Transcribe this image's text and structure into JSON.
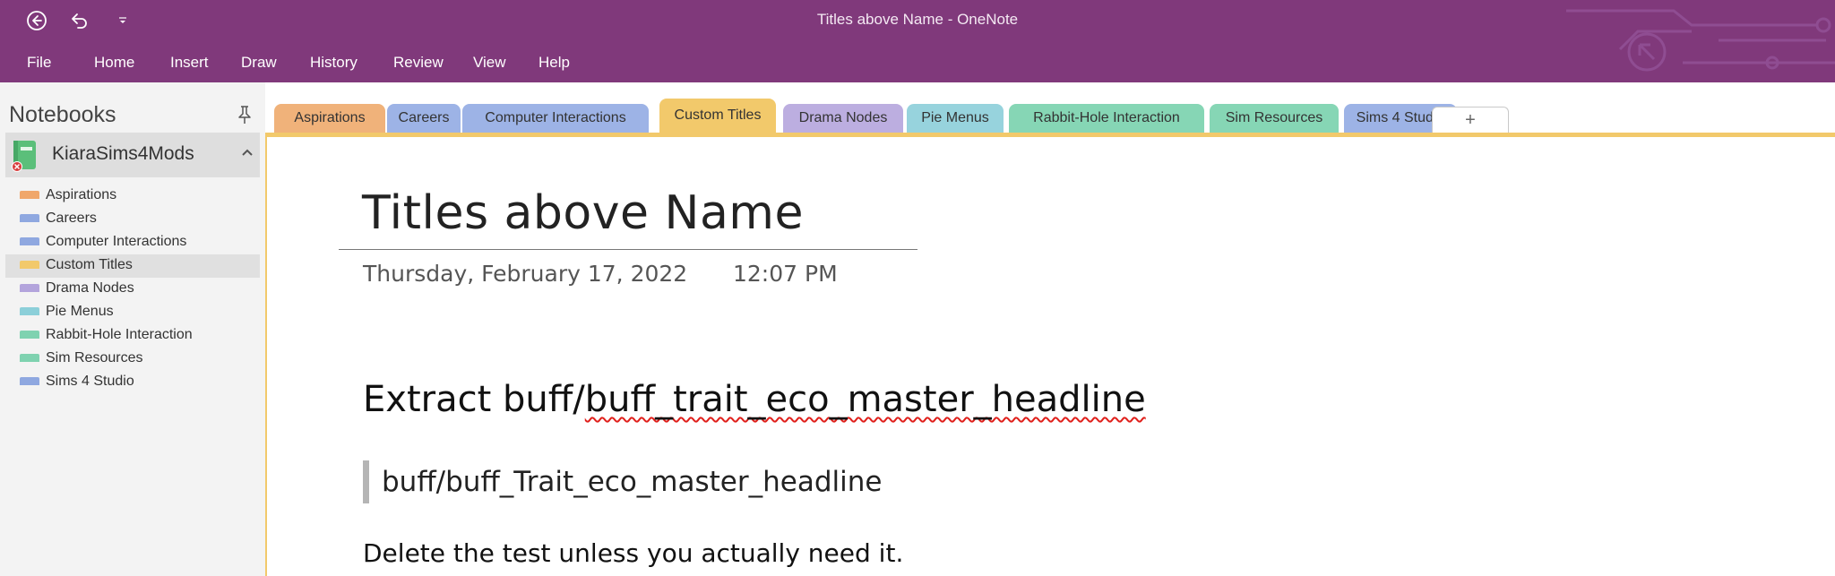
{
  "window": {
    "title": "Titles above Name  -  OneNote"
  },
  "qat": {
    "back_icon": "back-circle-icon",
    "undo_icon": "undo-icon",
    "customize_icon": "dropdown-caret-icon"
  },
  "ribbon": {
    "tabs": [
      "File",
      "Home",
      "Insert",
      "Draw",
      "History",
      "Review",
      "View",
      "Help"
    ]
  },
  "nav": {
    "title": "Notebooks",
    "notebook": {
      "name": "KiaraSims4Mods",
      "color": "#5bbf7a"
    },
    "sections": [
      {
        "label": "Aspirations",
        "color": "#f0a76b"
      },
      {
        "label": "Careers",
        "color": "#8fa8e0"
      },
      {
        "label": "Computer Interactions",
        "color": "#8fa8e0"
      },
      {
        "label": "Custom Titles",
        "color": "#f2c96b",
        "selected": true
      },
      {
        "label": "Drama Nodes",
        "color": "#b3a4dc"
      },
      {
        "label": "Pie Menus",
        "color": "#8ccfd9"
      },
      {
        "label": "Rabbit-Hole Interaction",
        "color": "#7fd2b0"
      },
      {
        "label": "Sim Resources",
        "color": "#7fd2b0"
      },
      {
        "label": "Sims 4 Studio",
        "color": "#8fa8e0"
      }
    ]
  },
  "section_tabs": [
    {
      "label": "Aspirations",
      "color": "#f0b27a"
    },
    {
      "label": "Careers",
      "color": "#9db3e6"
    },
    {
      "label": "Computer Interactions",
      "color": "#9db3e6"
    },
    {
      "label": "Custom Titles",
      "color": "#f2c96b",
      "active": true
    },
    {
      "label": "Drama Nodes",
      "color": "#bcaee0"
    },
    {
      "label": "Pie Menus",
      "color": "#97d3dd"
    },
    {
      "label": "Rabbit-Hole Interaction",
      "color": "#86d6b5"
    },
    {
      "label": "Sim Resources",
      "color": "#86d6b5"
    },
    {
      "label": "Sims 4 Studio",
      "color": "#9db3e6"
    },
    {
      "label": "+",
      "color": "#ffffff"
    }
  ],
  "page": {
    "title": "Titles above Name",
    "date": "Thursday, February 17, 2022",
    "time": "12:07 PM",
    "heading_prefix": "Extract buff/",
    "heading_misspelled": "buff_trait_eco_master_headline",
    "quote": "buff/buff_Trait_eco_master_headline",
    "paragraph": "Delete the test unless you actually need it."
  }
}
